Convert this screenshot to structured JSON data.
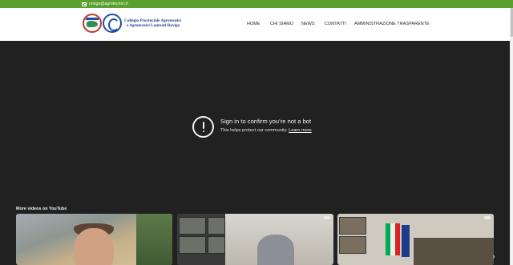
{
  "topbar": {
    "email": "rovigo@agrotecnici.it",
    "icon": "mail-icon"
  },
  "brand": {
    "line1": "Collegio Provinciale Agrotecnici",
    "line2": "e Agrotecnici Laureati Rovigo"
  },
  "nav": {
    "items": [
      "HOME",
      "CHI SIAMO",
      "NEWS",
      "CONTATTI",
      "AMMINISTRAZIONE TRASPARENTE"
    ]
  },
  "player": {
    "title": "Sign in to confirm you’re not a bot",
    "subtitle": "This helps protect our community.",
    "link": "Learn more",
    "more_videos": "More videos on YouTube",
    "next_icon": "chevron-right-icon"
  }
}
